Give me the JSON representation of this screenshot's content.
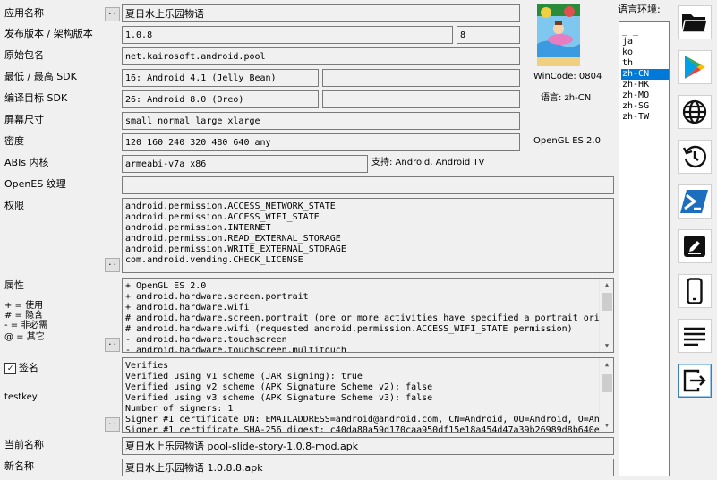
{
  "labels": {
    "app_name": "应用名称",
    "version": "发布版本 / 架构版本",
    "package": "原始包名",
    "sdk_min_max": "最低 / 最高 SDK",
    "target_sdk": "编译目标 SDK",
    "screen_size": "屏幕尺寸",
    "density": "密度",
    "abis": "ABIs 内核",
    "opengl_texture": "OpenES 纹理",
    "permissions": "权限",
    "features": "属性",
    "legend_used": "+ = 使用",
    "legend_implied": "# = 隐含",
    "legend_not_required": "- = 非必需",
    "legend_other": "@ = 其它",
    "signature": "签名",
    "key_name": "testkey",
    "current_name": "当前名称",
    "new_name": "新名称",
    "locale_env": "语言环境:",
    "dots": ".."
  },
  "fields": {
    "app_name": "夏日水上乐园物语",
    "version_name": "1.0.8",
    "version_code": "8",
    "package": "net.kairosoft.android.pool",
    "min_sdk": "16: Android 4.1 (Jelly Bean)",
    "max_sdk": "",
    "target_sdk": "26: Android 8.0 (Oreo)",
    "target_sdk_extra": "",
    "screen_size": "small normal large xlarge",
    "density": "120 160 240 320 480 640 any",
    "abis": "armeabi-v7a x86",
    "opengl_texture": "",
    "current_name": "夏日水上乐园物语 pool-slide-story-1.0.8-mod.apk",
    "new_name": "夏日水上乐园物语 1.0.8.8.apk"
  },
  "info": {
    "wincode": "WinCode: 0804",
    "language": "语言: zh-CN",
    "opengl": "OpenGL ES 2.0",
    "support": "支持: Android, Android TV"
  },
  "permissions": [
    "android.permission.ACCESS_NETWORK_STATE",
    "android.permission.ACCESS_WIFI_STATE",
    "android.permission.INTERNET",
    "android.permission.READ_EXTERNAL_STORAGE",
    "android.permission.WRITE_EXTERNAL_STORAGE",
    "com.android.vending.CHECK_LICENSE"
  ],
  "features": [
    "+ OpenGL ES 2.0",
    "+ android.hardware.screen.portrait",
    "+ android.hardware.wifi",
    "# android.hardware.screen.portrait (one or more activities have specified a portrait ori",
    "# android.hardware.wifi (requested android.permission.ACCESS_WIFI_STATE permission)",
    "- android.hardware.touchscreen",
    "- android.hardware.touchscreen.multitouch"
  ],
  "signature_lines": [
    "Verifies",
    "Verified using v1 scheme (JAR signing): true",
    "Verified using v2 scheme (APK Signature Scheme v2): false",
    "Verified using v3 scheme (APK Signature Scheme v3): false",
    "Number of signers: 1",
    "Signer #1 certificate DN: EMAILADDRESS=android@android.com, CN=Android, OU=Android, O=An",
    "Signer #1 certificate SHA-256 digest: c40da80a59d170caa950df15e18a454d47a39b26989d8b640e"
  ],
  "locales": [
    "_ _",
    "ja",
    "ko",
    "th",
    "zh-CN",
    "zh-HK",
    "zh-MO",
    "zh-SG",
    "zh-TW"
  ],
  "selected_locale": "zh-CN",
  "toolbar": [
    {
      "name": "open-folder-button",
      "icon": "folder-icon"
    },
    {
      "name": "google-play-button",
      "icon": "google-play-icon"
    },
    {
      "name": "web-button",
      "icon": "globe-icon"
    },
    {
      "name": "history-button",
      "icon": "history-icon"
    },
    {
      "name": "powershell-button",
      "icon": "terminal-icon"
    },
    {
      "name": "edit-button",
      "icon": "edit-icon"
    },
    {
      "name": "device-button",
      "icon": "phone-icon"
    },
    {
      "name": "details-button",
      "icon": "list-icon"
    },
    {
      "name": "export-button",
      "icon": "export-icon"
    }
  ],
  "colors": {
    "accent": "#0078d7",
    "field_border": "#7a7a7a",
    "background": "#f0f0f0"
  }
}
